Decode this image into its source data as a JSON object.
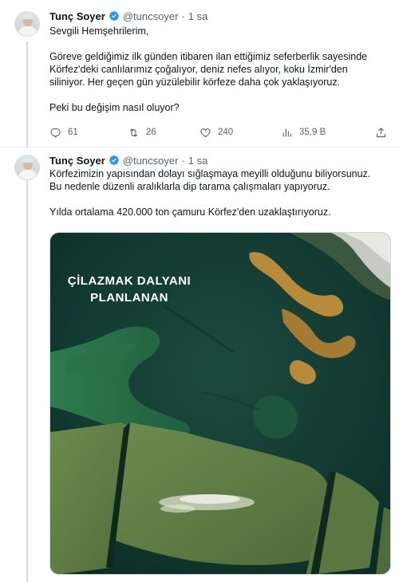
{
  "tweet1": {
    "author_name": "Tunç Soyer",
    "author_handle": "@tuncsoyer",
    "separator": "·",
    "time": "1 sa",
    "lines": [
      "Sevgili Hemşehrilerim,",
      "",
      "Göreve geldiğimiz ilk günden itibaren ilan ettiğimiz seferberlik sayesinde",
      "Körfez'deki canlılarımız çoğalıyor, deniz nefes alıyor, koku İzmir'den",
      "siliniyor. Her geçen gün yüzülebilir körfeze daha çok yaklaşıyoruz.",
      "",
      "Peki bu değişim nasıl oluyor?"
    ],
    "actions": {
      "replies": "61",
      "retweets": "26",
      "likes": "240",
      "views": "35,9 B"
    }
  },
  "tweet2": {
    "author_name": "Tunç Soyer",
    "author_handle": "@tuncsoyer",
    "separator": "·",
    "time": "1 sa",
    "lines": [
      "Körfezimizin yapısından dolayı sığlaşmaya meyilli olduğunu biliyorsunuz.",
      "Bu nedenle düzenli aralıklarla dip tarama çalışmaları yapıyoruz.",
      "",
      "Yılda ortalama 420.000 ton çamuru Körfez'den uzaklaştırıyoruz."
    ],
    "media": {
      "label_line1": "ÇİLAZMAK DALYANI",
      "label_line2": "PLANLANAN"
    }
  },
  "icons": {
    "verified": "verified-badge-icon",
    "reply": "reply-icon",
    "retweet": "retweet-icon",
    "like": "heart-icon",
    "views": "views-icon",
    "share": "share-icon"
  },
  "colors": {
    "verified_blue": "#1d9bf0",
    "secondary_text": "#536471",
    "primary_text": "#0f1419"
  }
}
